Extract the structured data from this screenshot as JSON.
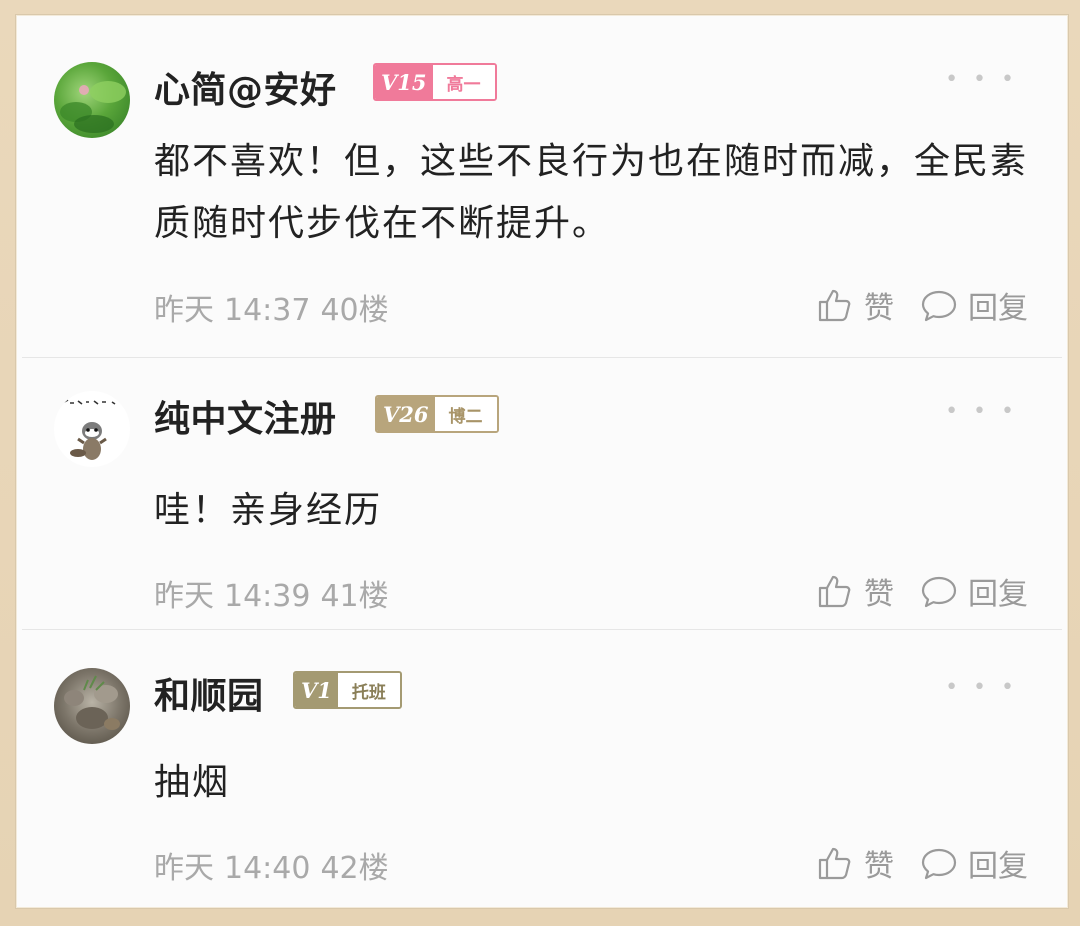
{
  "comments": [
    {
      "username": "心简@安好",
      "level": "V15",
      "rank": "高一",
      "badge_color": "#f07a9a",
      "content": "都不喜欢！但，这些不良行为也在随时而减，全民素质随时代步伐在不断提升。",
      "date": "昨天",
      "time": "14:37",
      "floor": "40楼",
      "like_label": "赞",
      "reply_label": "回复",
      "more_icon": "more-dots-icon"
    },
    {
      "username": "纯中文注册",
      "level": "V26",
      "rank": "博二",
      "badge_color": "#b8a57c",
      "content": "哇！亲身经历",
      "date": "昨天",
      "time": "14:39",
      "floor": "41楼",
      "like_label": "赞",
      "reply_label": "回复",
      "more_icon": "more-dots-icon"
    },
    {
      "username": "和顺园",
      "level": "V1",
      "rank": "托班",
      "badge_color": "#a49a72",
      "content": "抽烟",
      "date": "昨天",
      "time": "14:40",
      "floor": "42楼",
      "like_label": "赞",
      "reply_label": "回复",
      "more_icon": "more-dots-icon"
    }
  ],
  "colors": {
    "text_primary": "#222222",
    "text_meta": "#a9a9a9",
    "background": "#fbfbfb",
    "frame": "#e7d5b8"
  },
  "icons": [
    "thumbs-up-icon",
    "speech-bubble-icon",
    "more-dots-icon"
  ]
}
